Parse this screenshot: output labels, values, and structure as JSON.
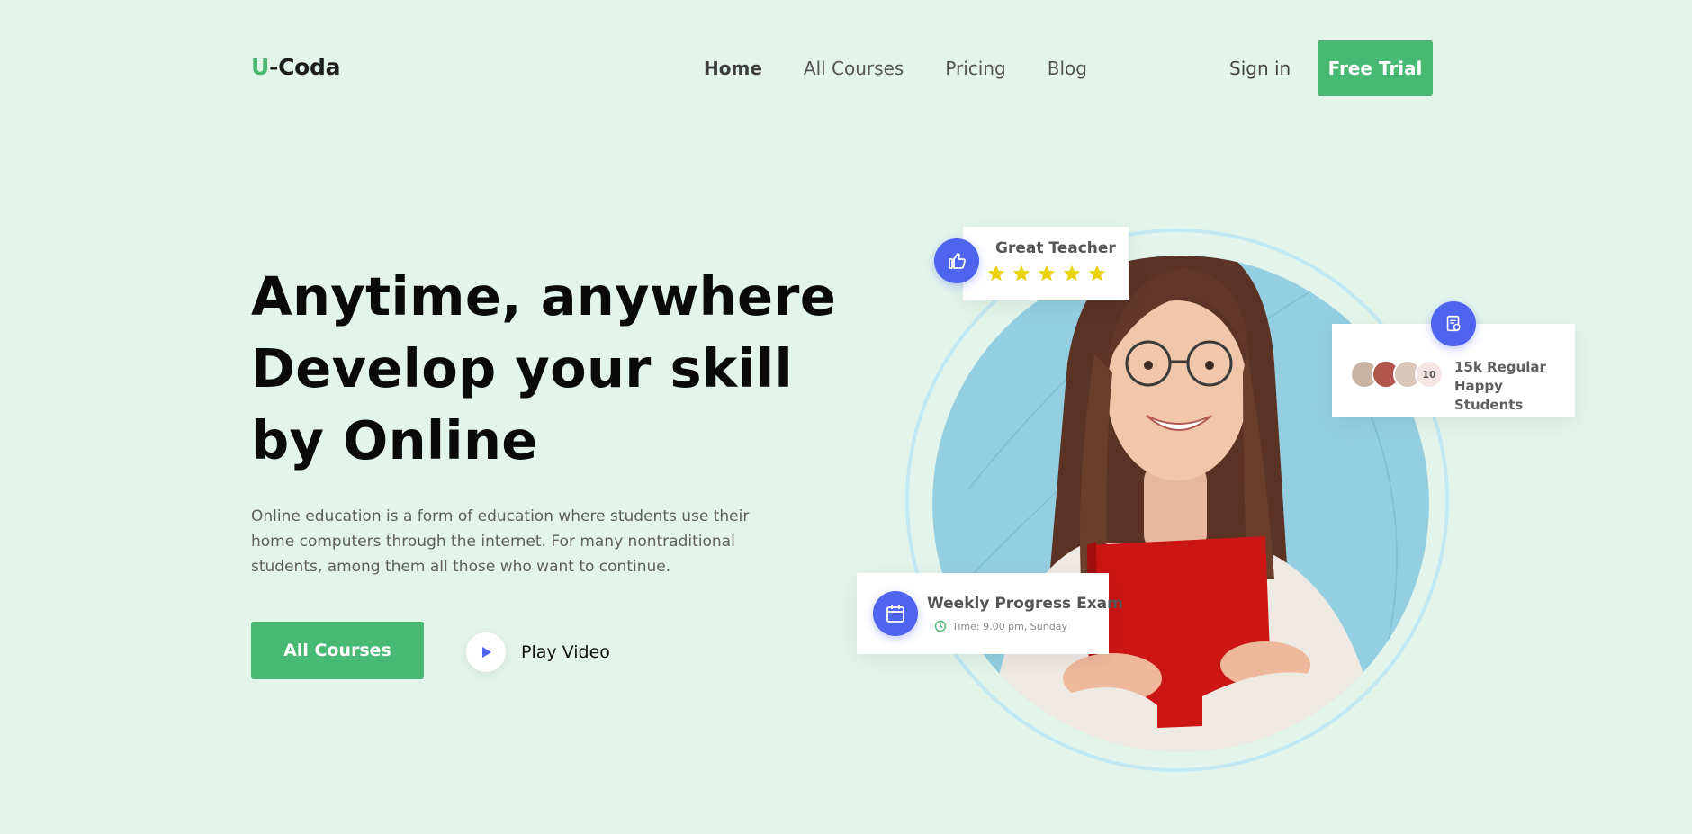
{
  "header": {
    "logo_letter": "U",
    "logo_rest": "-Coda",
    "nav": [
      "Home",
      "All Courses",
      "Pricing",
      "Blog"
    ],
    "signin": "Sign in",
    "trial": "Free Trial"
  },
  "hero": {
    "headline": [
      "Anytime, anywhere",
      "Develop your skill",
      "by Online"
    ],
    "description": "Online education is a form of education where students use their home computers through the internet. For many nontraditional students, among them all those who want to continue.",
    "primary_button": "All Courses",
    "play_label": "Play Video"
  },
  "cards": {
    "teacher": {
      "title": "Great Teacher",
      "rating": 5,
      "icon": "thumbs-up-icon"
    },
    "students": {
      "count_badge": "10",
      "line1": "15k Regular",
      "line2": "Happy Students",
      "icon": "clipboard-icon"
    },
    "exam": {
      "title": "Weekly Progress Exam",
      "time": "Time: 9.00 pm, Sunday",
      "icon": "calendar-icon"
    }
  },
  "colors": {
    "accent_green": "#47b972",
    "badge_blue": "#4e63ee",
    "background": "#e3f5eb",
    "star_yellow": "#e8d30d"
  }
}
